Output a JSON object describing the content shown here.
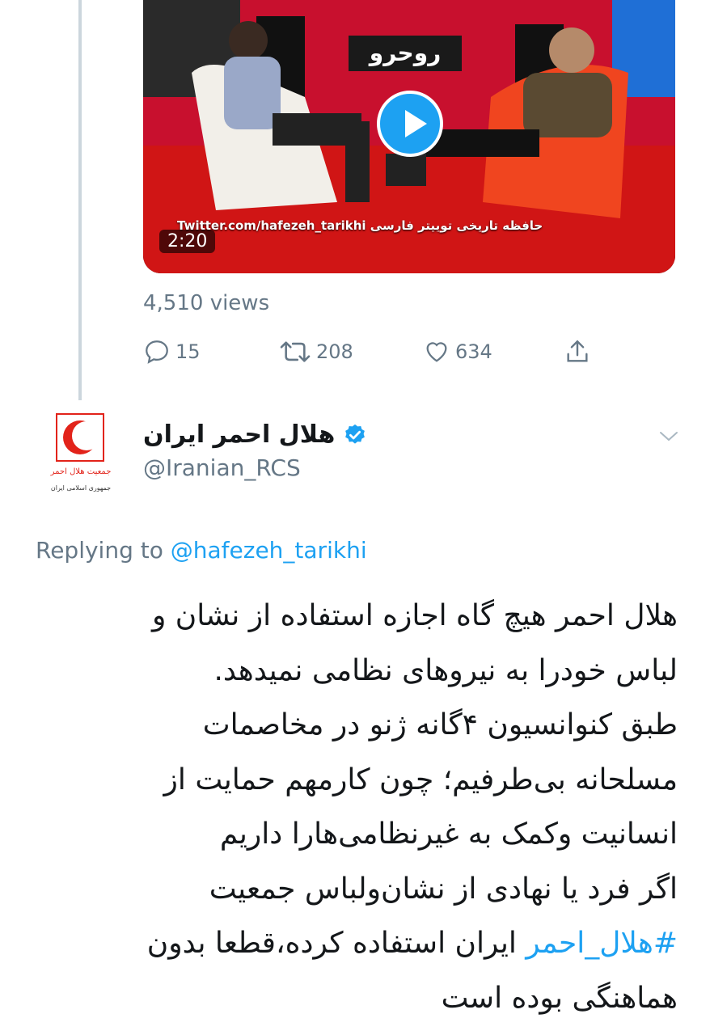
{
  "video": {
    "duration": "2:20",
    "watermark": "Twitter.com/hafezeh_tarikhi حافظه تاریخی توییتر فارسی",
    "studio_sign": "روحرو"
  },
  "stats": {
    "views": "4,510 views",
    "replies": "15",
    "retweets": "208",
    "likes": "634"
  },
  "author": {
    "display_name": "هلال احمر ایران",
    "handle": "@Iranian_RCS",
    "verified": true,
    "avatar_text_1": "جمعیت هلال احمر",
    "avatar_text_2": "جمهوری اسلامی ایران"
  },
  "reply": {
    "prefix": "Replying to ",
    "mention": "@hafezeh_tarikhi"
  },
  "tweet": {
    "text_before": "هلال احمر هیچ گاه اجازه استفاده از نشان و\nلباس خودرا به نیروهای نظامی نمیدهد.\nطبق کنوانسیون ۴گانه ژنو در مخاصمات\nمسلحانه بی‌طرفیم؛ چون کارمهم حمایت از\nانسانیت وکمک به غیرنظامی‌هارا داریم\nاگر فرد یا نهادی از نشان‌ولباس جمعیت\n",
    "hashtag": "#هلال_احمر",
    "text_after": " ایران استفاده کرده،قطعا بدون\nهماهنگی بوده است"
  },
  "colors": {
    "accent": "#1da1f2",
    "muted": "#657786",
    "red_crescent": "#e2231a"
  }
}
